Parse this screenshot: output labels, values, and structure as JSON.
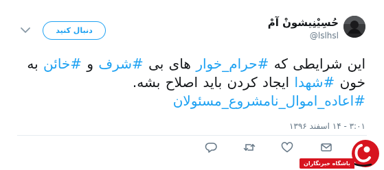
{
  "user": {
    "display_name": "حُسِیْنِیشونْ آمْ",
    "handle": "@lslhsl"
  },
  "follow_button": {
    "label": "دنبال کنید"
  },
  "tweet": {
    "segments": [
      {
        "text": "این شرایطی که ",
        "hashtag": false
      },
      {
        "text": "#حرام_خوار",
        "hashtag": true
      },
      {
        "text": " های بی ",
        "hashtag": false
      },
      {
        "text": "#شرف",
        "hashtag": true
      },
      {
        "text": " و ",
        "hashtag": false
      },
      {
        "text": "#خائن",
        "hashtag": true
      },
      {
        "text": " به خون ",
        "hashtag": false
      },
      {
        "text": "#شهدا",
        "hashtag": true
      },
      {
        "text": " ایجاد کردن باید اصلاح بشه. ",
        "hashtag": false
      },
      {
        "text": "#اعاده_اموال_نامشروع_مسئولان",
        "hashtag": true
      }
    ]
  },
  "timestamp": "۳:۰۱ - ۱۴ اسفند ۱۳۹۶",
  "actions": {
    "icons": [
      "reply-icon",
      "retweet-icon",
      "like-icon",
      "direct-message-icon"
    ]
  },
  "watermark": {
    "label": "باشگاه خبرنگاران",
    "brand_color": "#d7141f"
  },
  "colors": {
    "link": "#1da1f2",
    "text": "#14171a",
    "secondary": "#657786"
  }
}
